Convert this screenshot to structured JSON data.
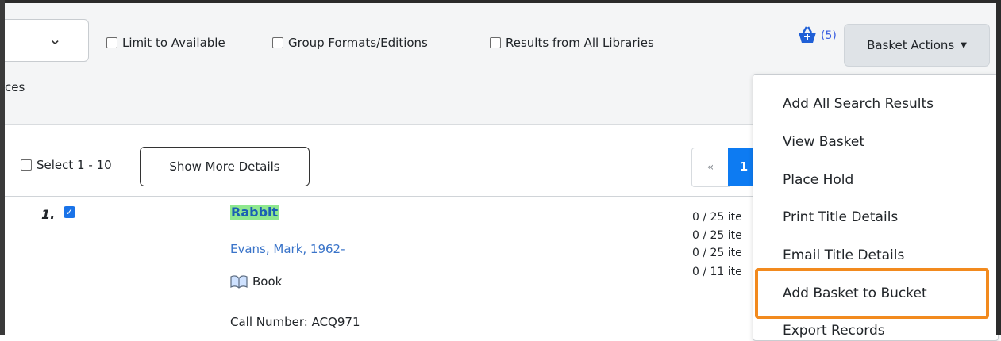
{
  "filters": {
    "limit_available": "Limit to Available",
    "group_formats": "Group Formats/Editions",
    "all_libraries": "Results from All Libraries",
    "cut_label": "ces"
  },
  "basket": {
    "count": "(5)",
    "actions_label": "Basket Actions",
    "menu": [
      "Add All Search Results",
      "View Basket",
      "Place Hold",
      "Print Title Details",
      "Email Title Details",
      "Add Basket to Bucket",
      "Export Records"
    ]
  },
  "toolbar": {
    "select_range": "Select 1 - 10",
    "show_more": "Show More Details"
  },
  "pager": {
    "prev": "«",
    "current": "1"
  },
  "result": {
    "number": "1.",
    "title": "Rabbit",
    "author": "Evans, Mark, 1962-",
    "format": "Book",
    "call_number": "Call Number: ACQ971",
    "availability": [
      "0 / 25 ite",
      "0 / 25 ite",
      "0 / 25 ite",
      "0 / 11 ite"
    ]
  }
}
